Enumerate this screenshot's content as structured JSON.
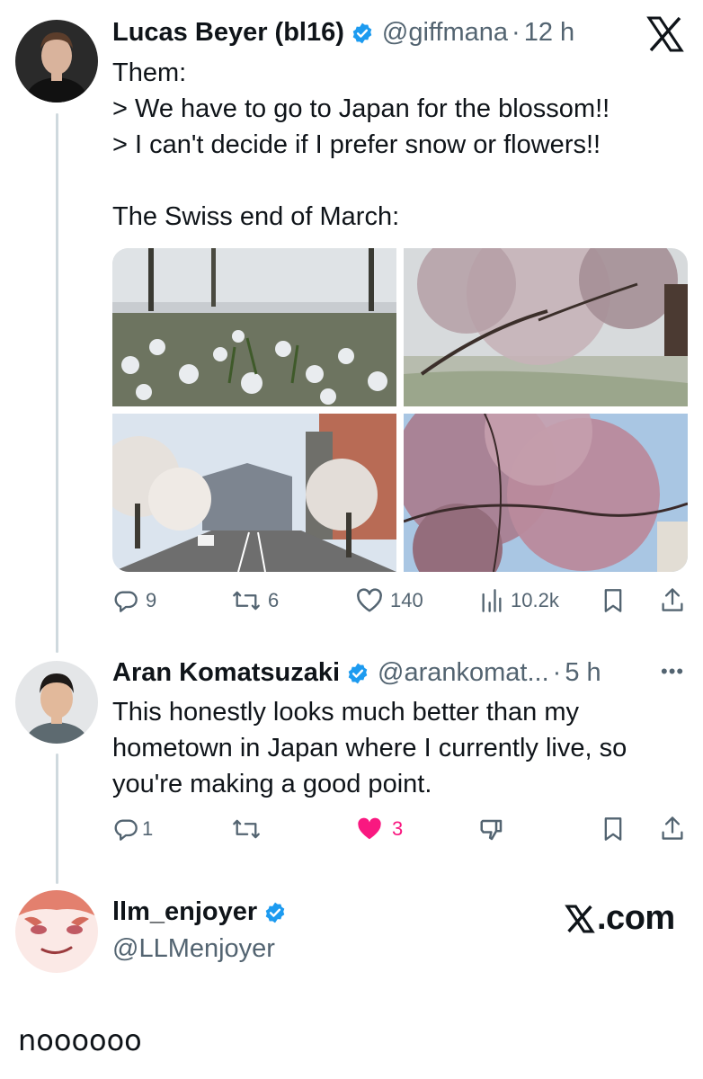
{
  "brand": {
    "logo": "X",
    "watermark": ".com"
  },
  "tweet1": {
    "display_name": "Lucas Beyer (bl16)",
    "handle": "@giffmana",
    "time": "12 h",
    "text": "Them:\n> We have to go to Japan for the blossom!!\n> I can't decide if I prefer snow or flowers!!\n\nThe Swiss end of March:",
    "actions": {
      "replies": "9",
      "reposts": "6",
      "likes": "140",
      "views": "10.2k"
    },
    "media": [
      "snowy-garden-photo",
      "cherry-tree-frost-photo",
      "tree-lined-street-photo",
      "pink-blossom-closeup-photo"
    ]
  },
  "tweet2": {
    "display_name": "Aran Komatsuzaki",
    "handle": "@arankomat...",
    "time": "5 h",
    "text": "This honestly looks much better than my\nhometown in Japan where I currently live, so\nyou're making a good point.",
    "actions": {
      "replies": "1",
      "reposts": "",
      "likes": "3"
    }
  },
  "tweet3": {
    "display_name": "llm_enjoyer",
    "handle": "@LLMenjoyer"
  },
  "reply": {
    "text": "noooooo"
  },
  "colors": {
    "verified": "#1d9bf0",
    "like": "#f91880",
    "secondary": "#536471",
    "thread": "#cfd9de"
  }
}
